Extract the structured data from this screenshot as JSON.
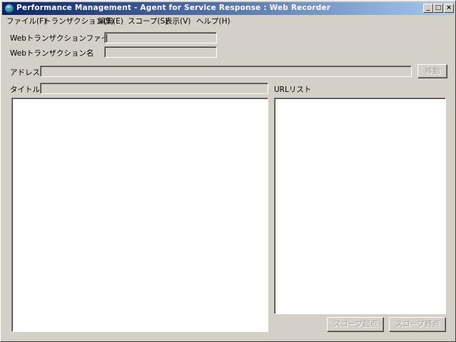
{
  "window": {
    "title": "Performance Management - Agent for Service Response : Web Recorder",
    "controls": {
      "minimize": "_",
      "maximize": "□",
      "close": "×"
    }
  },
  "menu": [
    {
      "label": "ファイル(F)"
    },
    {
      "label": "トランザクション(T)"
    },
    {
      "label": "編集(E)"
    },
    {
      "label": "スコープ(S)"
    },
    {
      "label": "表示(V)"
    },
    {
      "label": "ヘルプ(H)"
    }
  ],
  "form": {
    "file_name_label": "Webトランザクションファイル名",
    "file_name_value": "",
    "transaction_name_label": "Webトランザクション名",
    "transaction_name_value": "",
    "address_label": "アドレス",
    "address_value": "",
    "move_button": "移動",
    "title_label": "タイトル",
    "title_value": "",
    "url_list_label": "URLリスト"
  },
  "buttons": {
    "scope_start": "スコープ起点",
    "scope_end": "スコープ終点"
  }
}
